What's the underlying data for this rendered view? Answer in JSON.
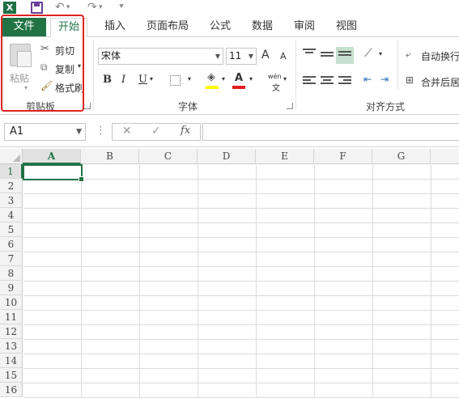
{
  "qat": {
    "logo": "X",
    "undo_icon": "undo-icon",
    "redo_icon": "redo-icon"
  },
  "tabs": [
    "文件",
    "开始",
    "插入",
    "页面布局",
    "公式",
    "数据",
    "审阅",
    "视图"
  ],
  "clipboard": {
    "paste": "粘贴",
    "cut": "剪切",
    "copy": "复制",
    "format_painter": "格式刷",
    "label": "剪贴板"
  },
  "font": {
    "name": "宋体",
    "size": "11",
    "bold": "B",
    "italic": "I",
    "underline": "U",
    "label": "字体",
    "grow": "A",
    "shrink": "A",
    "phonetic": "wén",
    "font_color_letter": "A"
  },
  "alignment": {
    "wrap": "自动换行",
    "merge": "合并后居",
    "label": "对齐方式"
  },
  "formula_bar": {
    "name_box": "A1",
    "fx": "fx",
    "cancel": "✕",
    "enter": "✓",
    "value": ""
  },
  "columns": [
    "A",
    "B",
    "C",
    "D",
    "E",
    "F",
    "G"
  ],
  "rows": [
    "1",
    "2",
    "3",
    "4",
    "5",
    "6",
    "7",
    "8",
    "9",
    "10",
    "11",
    "12",
    "13",
    "14",
    "15",
    "16"
  ],
  "colors": {
    "accent": "#217346",
    "highlight": "#ffff00",
    "font_red": "#e02020"
  }
}
